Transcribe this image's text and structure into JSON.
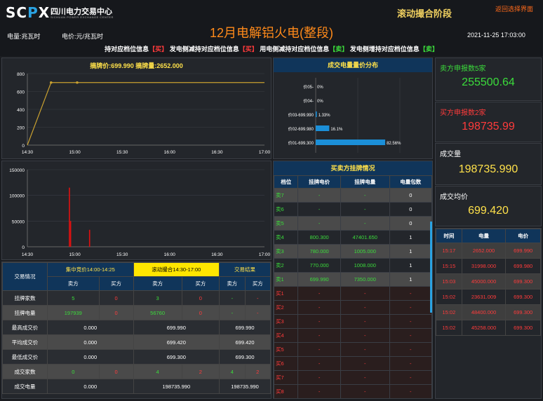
{
  "header": {
    "logo": "SCPX",
    "org_cn": "四川电力交易中心",
    "org_en": "SICHUAN POWER EXCHANGE CENTER",
    "phase": "滚动撮合阶段",
    "back": "返回选择界面",
    "title": "12月电解铝火电(整段)",
    "unit_energy": "电量:兆瓦时",
    "unit_price": "电价:元/兆瓦时",
    "datetime": "2021-11-25 17:03:00",
    "status": [
      {
        "text": "持对应档位信息",
        "tag": "【买】",
        "color": "red"
      },
      {
        "text": "发电侧减持对应档位信息",
        "tag": "【买】",
        "color": "red"
      },
      {
        "text": "用电侧减持对应档位信息",
        "tag": "【卖】",
        "color": "green"
      },
      {
        "text": "发电侧增持对应档位信息",
        "tag": "【卖】",
        "color": "green"
      }
    ]
  },
  "price_chart": {
    "header": "摘牌价:699.990 摘牌量:2652.000",
    "chart_data": {
      "type": "line",
      "x": [
        "14:30",
        "15:00",
        "15:30",
        "16:00",
        "16:30",
        "17:00"
      ],
      "yticks": [
        0,
        200,
        400,
        600,
        800
      ],
      "ylim": [
        0,
        800
      ],
      "series": [
        {
          "points": [
            [
              0,
              0
            ],
            [
              0.1,
              700
            ],
            [
              0.11,
              700
            ],
            [
              0.2,
              700
            ],
            [
              1,
              700
            ]
          ]
        }
      ]
    }
  },
  "volume_chart": {
    "chart_data": {
      "type": "bar",
      "x": [
        "14:30",
        "15:00",
        "15:30",
        "16:00",
        "16:30",
        "17:00"
      ],
      "yticks": [
        0,
        50000,
        100000,
        150000
      ],
      "ylim": [
        0,
        150000
      ],
      "bars": [
        {
          "t": 0.175,
          "v": 115000
        },
        {
          "t": 0.18,
          "v": 50000
        },
        {
          "t": 0.26,
          "v": 33000
        }
      ]
    }
  },
  "dist": {
    "title": "成交电量量价分布",
    "chart_data": {
      "type": "bar",
      "categories": [
        "价05-",
        "价04-",
        "价03-699.990",
        "价02-699.980",
        "价01-699.300"
      ],
      "values": [
        0,
        0,
        1.33,
        16.1,
        82.56
      ],
      "labels": [
        "0%",
        "0%",
        "1.33%",
        "16.1%",
        "82.56%"
      ]
    }
  },
  "book": {
    "title": "买卖方挂牌情况",
    "cols": [
      "档位",
      "挂牌电价",
      "挂牌电量",
      "电量包数"
    ],
    "rows": [
      [
        "卖7",
        "-",
        "-",
        "0"
      ],
      [
        "卖6",
        "-",
        "-",
        "0"
      ],
      [
        "卖5",
        "-",
        "-",
        "0"
      ],
      [
        "卖4",
        "800.300",
        "47401.650",
        "1"
      ],
      [
        "卖3",
        "780.000",
        "1005.000",
        "1"
      ],
      [
        "卖2",
        "770.000",
        "1008.000",
        "1"
      ],
      [
        "卖1",
        "699.990",
        "7350.000",
        "1"
      ],
      [
        "买1",
        "-",
        "-",
        "-"
      ],
      [
        "买2",
        "-",
        "-",
        "-"
      ],
      [
        "买3",
        "-",
        "-",
        "-"
      ],
      [
        "买4",
        "-",
        "-",
        "-"
      ],
      [
        "买5",
        "-",
        "-",
        "-"
      ],
      [
        "买6",
        "-",
        "-",
        "-"
      ],
      [
        "买7",
        "-",
        "-",
        "-"
      ],
      [
        "买8",
        "-",
        "-",
        "-"
      ]
    ]
  },
  "stats": {
    "sellers_label": "卖方申报数5家",
    "sellers_value": "255500.64",
    "buyers_label": "买方申报数2家",
    "buyers_value": "198735.99",
    "volume_label": "成交量",
    "volume_value": "198735.990",
    "avg_label": "成交均价",
    "avg_value": "699.420"
  },
  "trades": {
    "cols": [
      "时间",
      "电量",
      "电价"
    ],
    "rows": [
      [
        "15:17",
        "2652.000",
        "699.990"
      ],
      [
        "15:15",
        "31998.000",
        "699.980"
      ],
      [
        "15:03",
        "45000.000",
        "699.300"
      ],
      [
        "15:02",
        "23631.009",
        "699.300"
      ],
      [
        "15:02",
        "48400.000",
        "699.300"
      ],
      [
        "15:02",
        "45258.000",
        "699.300"
      ]
    ]
  },
  "summary": {
    "label": "交易情况",
    "phases": [
      "集中竞价14:00-14:25",
      "滚动撮合14:30-17:00",
      "交易结果"
    ],
    "sides": [
      "卖方",
      "买方",
      "卖方",
      "买方",
      "卖方",
      "买方"
    ],
    "rows": [
      {
        "name": "挂牌家数",
        "cells": [
          "5",
          "0",
          "3",
          "0",
          "-",
          "-"
        ]
      },
      {
        "name": "挂牌电量",
        "cells": [
          "197939",
          "0",
          "56760",
          "0",
          "-",
          "-"
        ]
      },
      {
        "name": "最高成交价",
        "cells": [
          "0.000",
          "699.990",
          "699.990"
        ]
      },
      {
        "name": "平均成交价",
        "cells": [
          "0.000",
          "699.420",
          "699.420"
        ]
      },
      {
        "name": "最低成交价",
        "cells": [
          "0.000",
          "699.300",
          "699.300"
        ]
      },
      {
        "name": "成交家数",
        "cells": [
          "0",
          "0",
          "4",
          "2",
          "4",
          "2"
        ]
      },
      {
        "name": "成交电量",
        "cells": [
          "0.000",
          "198735.990",
          "198735.990"
        ]
      }
    ]
  },
  "colors": {
    "accent": "#ffe14a",
    "header": "#10355a",
    "red": "#ff3b3b",
    "green": "#3bdc3b",
    "orange": "#ff8a1a",
    "line": "#c8a030"
  }
}
